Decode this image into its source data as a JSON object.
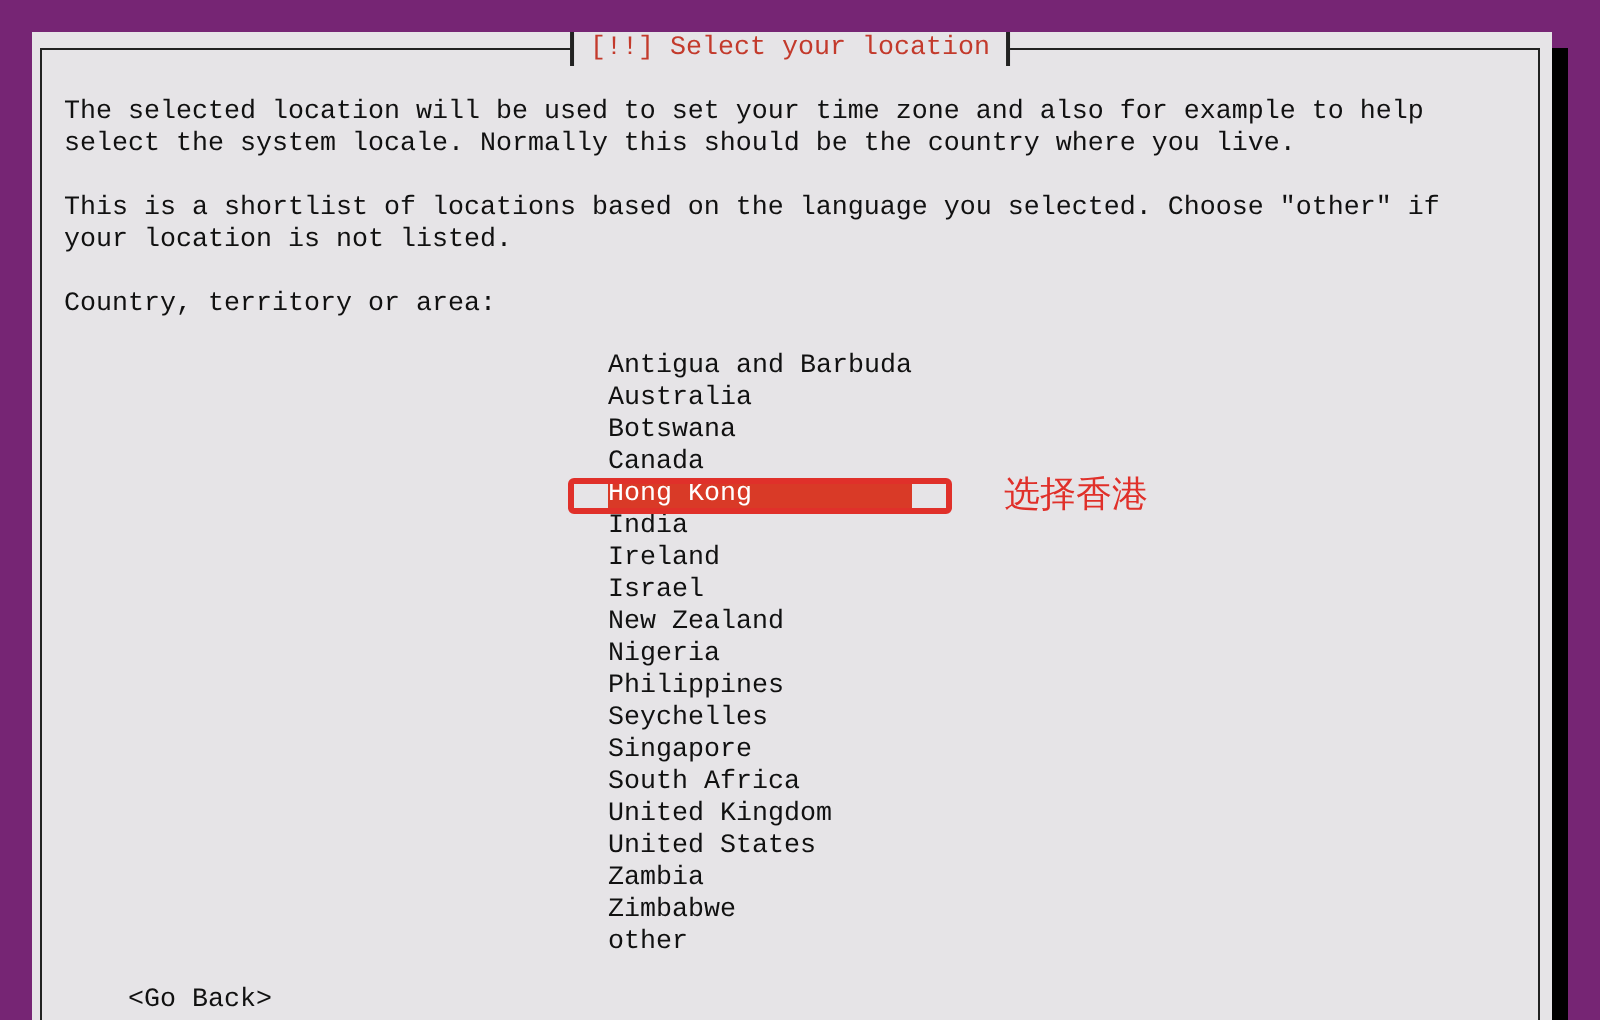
{
  "dialog": {
    "title": "[!!] Select your location",
    "paragraphs": [
      "The selected location will be used to set your time zone and also for example to help select the system locale. Normally this should be the country where you live.",
      "This is a shortlist of locations based on the language you selected. Choose \"other\" if your location is not listed."
    ],
    "prompt": "Country, territory or area:"
  },
  "locations": [
    {
      "label": "Antigua and Barbuda",
      "selected": false
    },
    {
      "label": "Australia",
      "selected": false
    },
    {
      "label": "Botswana",
      "selected": false
    },
    {
      "label": "Canada",
      "selected": false
    },
    {
      "label": "Hong Kong",
      "selected": true
    },
    {
      "label": "India",
      "selected": false
    },
    {
      "label": "Ireland",
      "selected": false
    },
    {
      "label": "Israel",
      "selected": false
    },
    {
      "label": "New Zealand",
      "selected": false
    },
    {
      "label": "Nigeria",
      "selected": false
    },
    {
      "label": "Philippines",
      "selected": false
    },
    {
      "label": "Seychelles",
      "selected": false
    },
    {
      "label": "Singapore",
      "selected": false
    },
    {
      "label": "South Africa",
      "selected": false
    },
    {
      "label": "United Kingdom",
      "selected": false
    },
    {
      "label": "United States",
      "selected": false
    },
    {
      "label": "Zambia",
      "selected": false
    },
    {
      "label": "Zimbabwe",
      "selected": false
    },
    {
      "label": "other",
      "selected": false
    }
  ],
  "annotation": {
    "text": "选择香港"
  },
  "buttons": [
    {
      "label": "<Go Back>"
    }
  ]
}
